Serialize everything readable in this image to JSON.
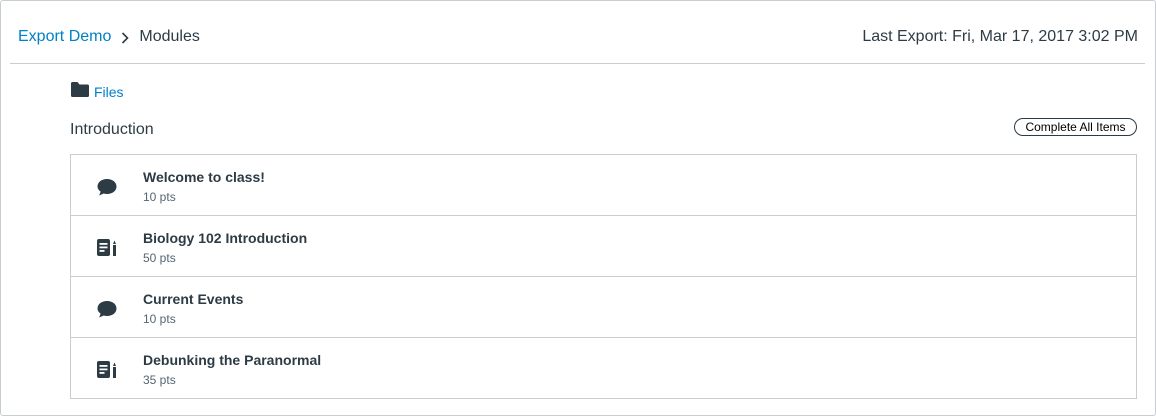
{
  "breadcrumb": {
    "course": "Export Demo",
    "current": "Modules"
  },
  "last_export": "Last Export: Fri, Mar 17, 2017 3:02 PM",
  "files": {
    "label": "Files",
    "icon": "folder-icon"
  },
  "module": {
    "title": "Introduction",
    "complete_all_label": "Complete All Items",
    "items": [
      {
        "title": "Welcome to class!",
        "points": "10 pts",
        "icon": "discussion-icon"
      },
      {
        "title": "Biology 102 Introduction",
        "points": "50 pts",
        "icon": "assignment-icon"
      },
      {
        "title": "Current Events",
        "points": "10 pts",
        "icon": "discussion-icon"
      },
      {
        "title": "Debunking the Paranormal",
        "points": "35 pts",
        "icon": "assignment-icon"
      }
    ]
  },
  "colors": {
    "link": "#0081c6",
    "text": "#2d3b45",
    "border": "#c7cdd1",
    "muted": "#556572"
  }
}
